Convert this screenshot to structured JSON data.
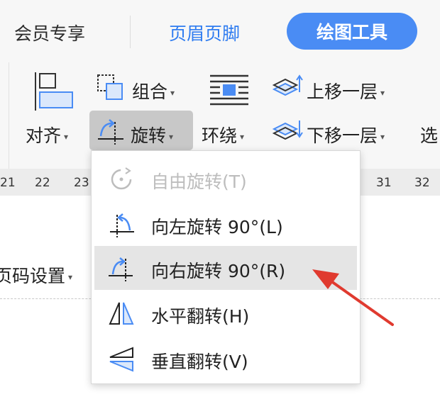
{
  "tabs": {
    "member": "会员专享",
    "header_footer": "页眉页脚",
    "drawing_tools": "绘图工具"
  },
  "ribbon": {
    "align": "对齐",
    "group": "组合",
    "rotate": "旋转",
    "wrap": "环绕",
    "bring_forward": "上移一层",
    "send_backward": "下移一层",
    "select": "选"
  },
  "ruler": [
    "21",
    "22",
    "23",
    "31",
    "32"
  ],
  "doc": {
    "page_number_settings": "页码设置"
  },
  "rotate_menu": {
    "items": [
      {
        "label": "自由旋转(T)",
        "icon": "free-rotate-icon",
        "enabled": false
      },
      {
        "label": "向左旋转 90°(L)",
        "icon": "rotate-left-icon",
        "enabled": true
      },
      {
        "label": "向右旋转 90°(R)",
        "icon": "rotate-right-icon",
        "enabled": true,
        "highlighted": true
      },
      {
        "label": "水平翻转(H)",
        "icon": "flip-horizontal-icon",
        "enabled": true
      },
      {
        "label": "垂直翻转(V)",
        "icon": "flip-vertical-icon",
        "enabled": true
      }
    ]
  },
  "colors": {
    "accent": "#4a8cf4",
    "link_tab": "#2f7cf0",
    "annotation_arrow": "#e03a2f"
  }
}
